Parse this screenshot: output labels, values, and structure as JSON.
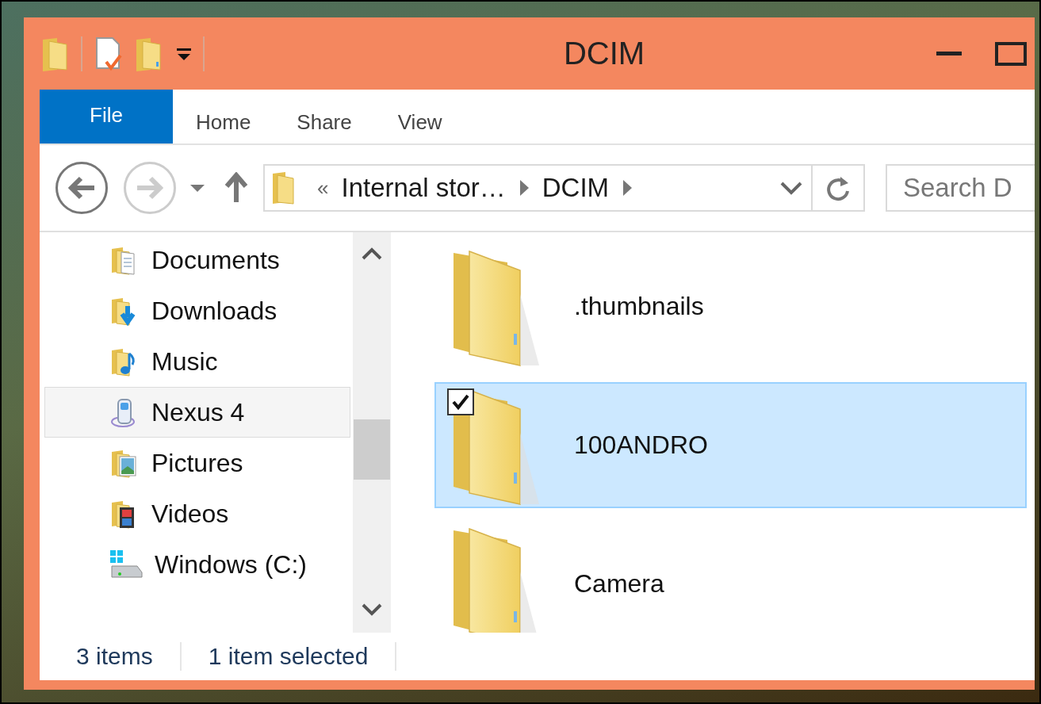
{
  "window": {
    "title": "DCIM"
  },
  "ribbon_tabs": [
    {
      "label": "File",
      "kind": "file",
      "selected": false
    },
    {
      "label": "Home",
      "kind": "tab",
      "selected": false
    },
    {
      "label": "Share",
      "kind": "tab",
      "selected": false
    },
    {
      "label": "View",
      "kind": "tab",
      "selected": false
    }
  ],
  "navigation": {
    "back_disabled": false,
    "forward_disabled": true
  },
  "address_bar": {
    "overflow": "«",
    "breadcrumbs": [
      "Internal stor…",
      "DCIM"
    ]
  },
  "search": {
    "placeholder": "Search D"
  },
  "nav_pane": {
    "items": [
      {
        "label": "Documents",
        "kind": "documents",
        "selected": false
      },
      {
        "label": "Downloads",
        "kind": "downloads",
        "selected": false
      },
      {
        "label": "Music",
        "kind": "music",
        "selected": false
      },
      {
        "label": "Nexus 4",
        "kind": "phone",
        "selected": true
      },
      {
        "label": "Pictures",
        "kind": "pictures",
        "selected": false
      },
      {
        "label": "Videos",
        "kind": "videos",
        "selected": false
      },
      {
        "label": "Windows (C:)",
        "kind": "drive",
        "selected": false
      }
    ]
  },
  "files": [
    {
      "name": ".thumbnails",
      "selected": false,
      "checked": false
    },
    {
      "name": "100ANDRO",
      "selected": true,
      "checked": true
    },
    {
      "name": "Camera",
      "selected": false,
      "checked": false
    }
  ],
  "status_bar": {
    "item_count": "3 items",
    "selection": "1 item selected"
  }
}
